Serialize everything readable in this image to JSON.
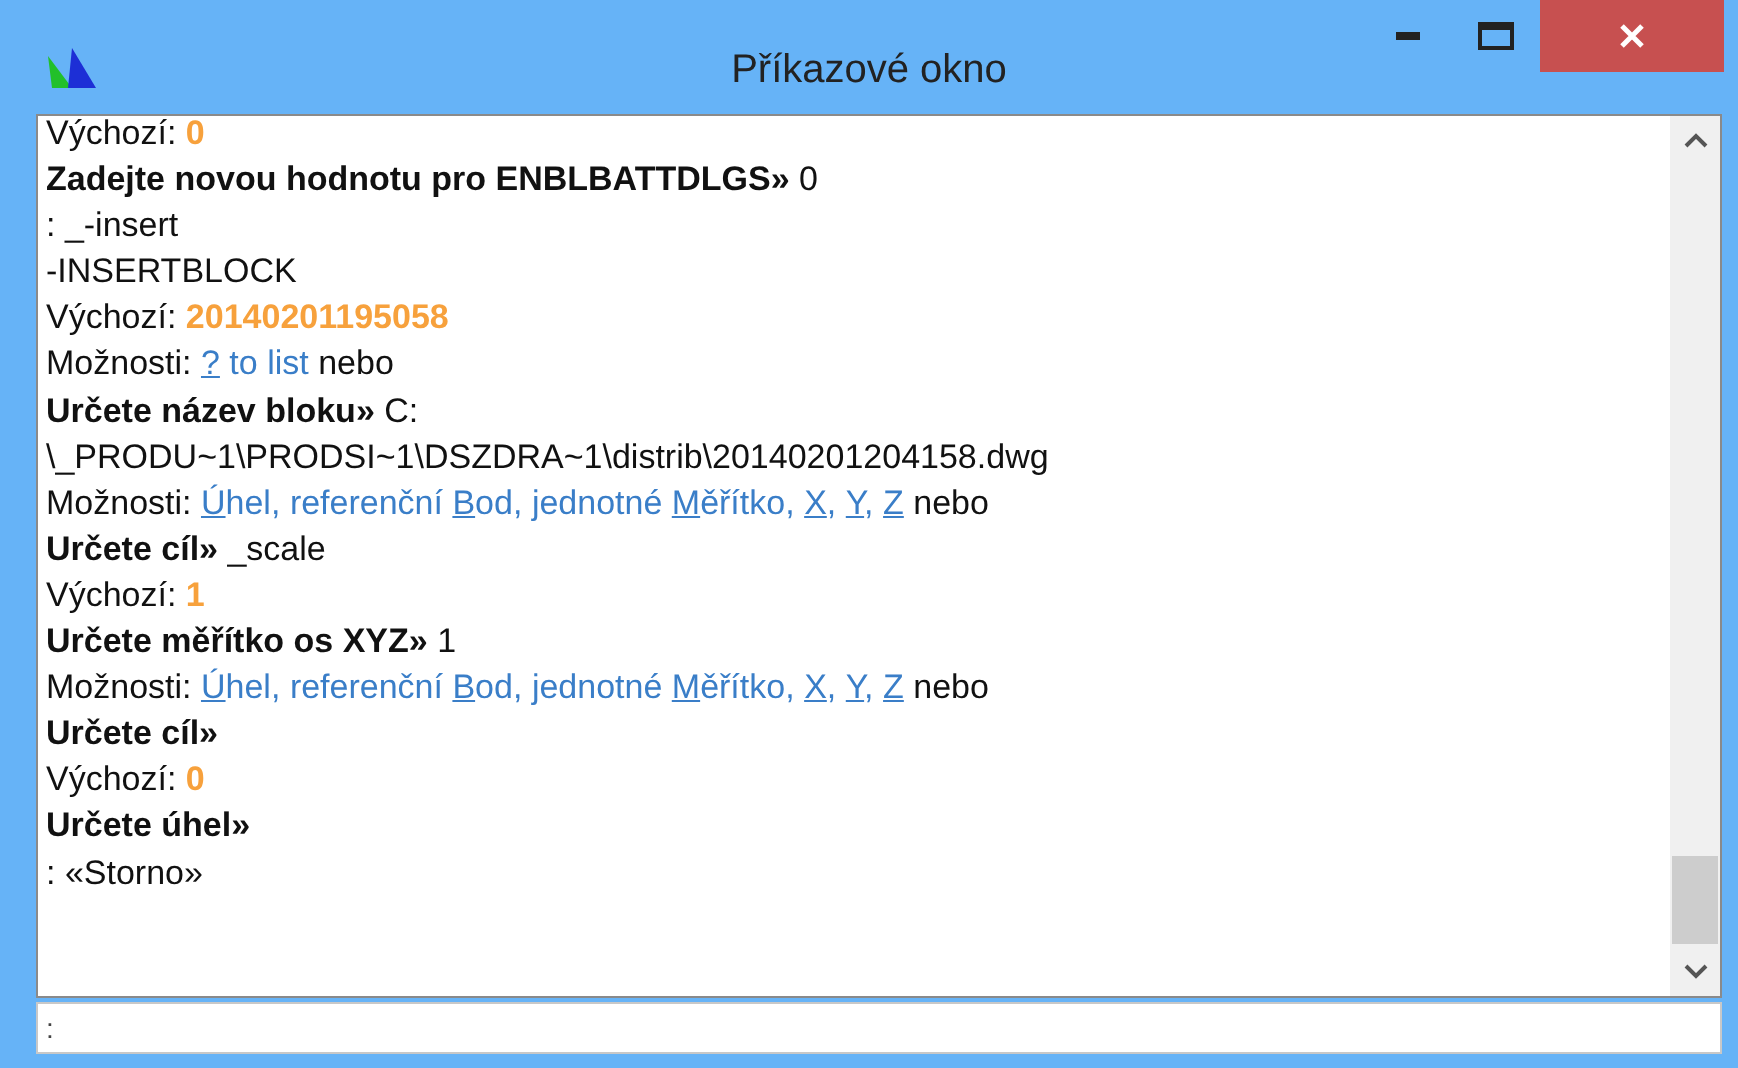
{
  "window": {
    "title": "Příkazové okno"
  },
  "history": [
    [
      {
        "kind": "plain",
        "text": "Výchozí: "
      },
      {
        "kind": "value",
        "text": "0"
      }
    ],
    [
      {
        "kind": "bold",
        "text": "Zadejte novou hodnotu pro ENBLBATTDLGS»"
      },
      {
        "kind": "plain",
        "text": " 0"
      }
    ],
    [
      {
        "kind": "plain",
        "text": ": _-insert"
      }
    ],
    [
      {
        "kind": "plain",
        "text": "-INSERTBLOCK"
      }
    ],
    [
      {
        "kind": "plain",
        "text": "Výchozí: "
      },
      {
        "kind": "value",
        "text": "20140201195058"
      }
    ],
    [
      {
        "kind": "plain",
        "text": "Možnosti: "
      },
      {
        "kind": "option",
        "key": "?",
        "post": " to list"
      },
      {
        "kind": "plain",
        "text": " nebo"
      }
    ],
    [
      {
        "kind": "bold",
        "text": "Určete název bloku»"
      },
      {
        "kind": "plain",
        "text": " C:"
      }
    ],
    [
      {
        "kind": "plain",
        "text": "\\_PRODU~1\\PRODSI~1\\DSZDRA~1\\distrib\\20140201204158.dwg"
      }
    ],
    [
      {
        "kind": "plain",
        "text": "Možnosti: "
      },
      {
        "kind": "option",
        "key": "Ú",
        "post": "hel,"
      },
      {
        "kind": "option",
        "pre": "referenční ",
        "key": "B",
        "post": "od,"
      },
      {
        "kind": "option",
        "pre": "jednotné ",
        "key": "M",
        "post": "ěřítko,"
      },
      {
        "kind": "option",
        "key": "X",
        "post": ","
      },
      {
        "kind": "option",
        "key": "Y",
        "post": ","
      },
      {
        "kind": "option",
        "key": "Z"
      },
      {
        "kind": "plain",
        "text": " nebo"
      }
    ],
    [
      {
        "kind": "bold",
        "text": "Určete cíl»"
      },
      {
        "kind": "plain",
        "text": " _scale"
      }
    ],
    [
      {
        "kind": "plain",
        "text": "Výchozí: "
      },
      {
        "kind": "value",
        "text": "1"
      }
    ],
    [
      {
        "kind": "bold",
        "text": "Určete měřítko os XYZ»"
      },
      {
        "kind": "plain",
        "text": " 1"
      }
    ],
    [
      {
        "kind": "plain",
        "text": "Možnosti: "
      },
      {
        "kind": "option",
        "key": "Ú",
        "post": "hel,"
      },
      {
        "kind": "option",
        "pre": "referenční ",
        "key": "B",
        "post": "od,"
      },
      {
        "kind": "option",
        "pre": "jednotné ",
        "key": "M",
        "post": "ěřítko,"
      },
      {
        "kind": "option",
        "key": "X",
        "post": ","
      },
      {
        "kind": "option",
        "key": "Y",
        "post": ","
      },
      {
        "kind": "option",
        "key": "Z"
      },
      {
        "kind": "plain",
        "text": " nebo"
      }
    ],
    [
      {
        "kind": "bold",
        "text": "Určete cíl»"
      }
    ],
    [
      {
        "kind": "plain",
        "text": "Výchozí: "
      },
      {
        "kind": "value",
        "text": "0"
      }
    ],
    [
      {
        "kind": "bold",
        "text": "Určete úhel»"
      }
    ],
    [
      {
        "kind": "plain",
        "text": ": «Storno»"
      }
    ]
  ],
  "command_line": {
    "prompt": ":"
  }
}
